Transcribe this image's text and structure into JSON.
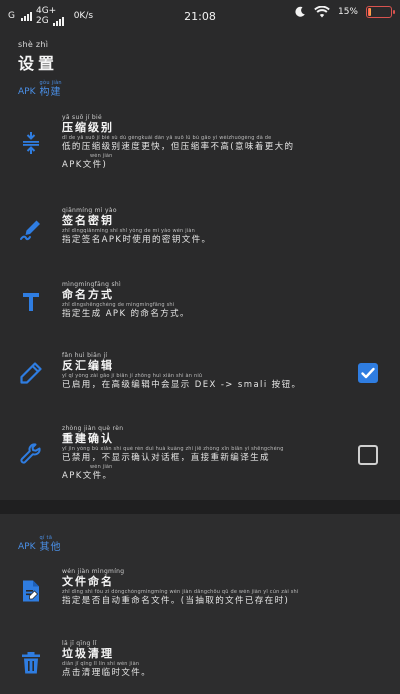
{
  "status_bar": {
    "net1": "G",
    "net2_top": "4G+",
    "net2_bottom": "2G",
    "speed": "0K/s",
    "time": "21:08",
    "battery_pct": "15%",
    "battery_level": 0.15,
    "icons": [
      "signal-icon",
      "moon-icon",
      "wifi-icon",
      "battery-icon"
    ]
  },
  "page": {
    "title_ruby": "shè  zhì",
    "title": "设置"
  },
  "sections": [
    {
      "abbr": "APK",
      "ruby": "gòu jiàn",
      "label": "构建"
    },
    {
      "abbr": "APK",
      "ruby": "qí tā",
      "label": "其他"
    }
  ],
  "items": [
    {
      "icon": "compress-icon",
      "title_ruby": "yā   suō   jí   bié",
      "title": "压缩级别",
      "desc_ruby": "dī  de  yā suō  jí  bié  sù  dù gèngkuài    dàn yā suō  lǜ   bù  gāo    yì  wèizhuógèng dà  de",
      "desc": "低的压缩级别速度更快，但压缩率不高(意味着更大的",
      "desc_ruby2": "wén jiàn",
      "desc2": "APK文件)",
      "checkbox": null
    },
    {
      "icon": "signature-icon",
      "title_ruby": "qiānmíng  mì  yào",
      "title": "签名密钥",
      "desc_ruby": "zhǐ dìngqiānmíng          shí shǐ yòng de   mì  yào wén jiàn",
      "desc": "指定签名APK时使用的密钥文件。",
      "desc_ruby2": "",
      "desc2": "",
      "checkbox": null
    },
    {
      "icon": "text-format-icon",
      "title_ruby": "mìngmíngfāng shì",
      "title": "命名方式",
      "desc_ruby": "zhǐ dìngshēngchéng           de mìngmíngfāng shì",
      "desc": "指定生成 APK 的命名方式。",
      "desc_ruby2": "",
      "desc2": "",
      "checkbox": null
    },
    {
      "icon": "pencil-icon",
      "title_ruby": "fǎn  huì biān   jí",
      "title": "反汇编辑",
      "desc_ruby": "yǐ   qǐ yòng     zài gāo   jí  biān   jí  zhōng huì xiǎn shì                         àn  niǔ",
      "desc": "已启用，在高级编辑中会显示 DEX -> smali 按钮。",
      "desc_ruby2": "",
      "desc2": "",
      "checkbox": true
    },
    {
      "icon": "wrench-icon",
      "title_ruby": "zhòng jiàn  què  rèn",
      "title": "重建确认",
      "desc_ruby": "yǐ   jìn yòng     bù xiǎn shì què  rèn duì huà kuàng        zhí  jiē zhòng xīn biān yì shēngchéng",
      "desc": "已禁用，不显示确认对话框，直接重新编译生成",
      "desc_ruby2": "wén jiàn",
      "desc2": "APK文件。",
      "checkbox": false
    },
    {
      "icon": "file-rename-icon",
      "title_ruby": "wén  jiàn mìngmíng",
      "title": "文件命名",
      "desc_ruby": "zhǐ dìng shì fǒu  zì  dòngchóngmìngmíng wén jiàn      dāngchōu qǔ  de wén jiàn yǐ  cún zài shí",
      "desc": "指定是否自动重命名文件。(当抽取的文件已存在时)",
      "desc_ruby2": "",
      "desc2": "",
      "checkbox": null
    },
    {
      "icon": "trash-icon",
      "title_ruby": "lā   jī   qīng   lǐ",
      "title": "垃圾清理",
      "desc_ruby": "diǎn  jī  qīng  lǐ    lín  shí wén jiàn",
      "desc": "点击清理临时文件。",
      "desc_ruby2": "",
      "desc2": "",
      "checkbox": null
    }
  ],
  "colors": {
    "background": "#2a2a2b",
    "accent": "#2f7de1",
    "section_text": "#4a8fe6",
    "divider": "#1f1f20"
  }
}
